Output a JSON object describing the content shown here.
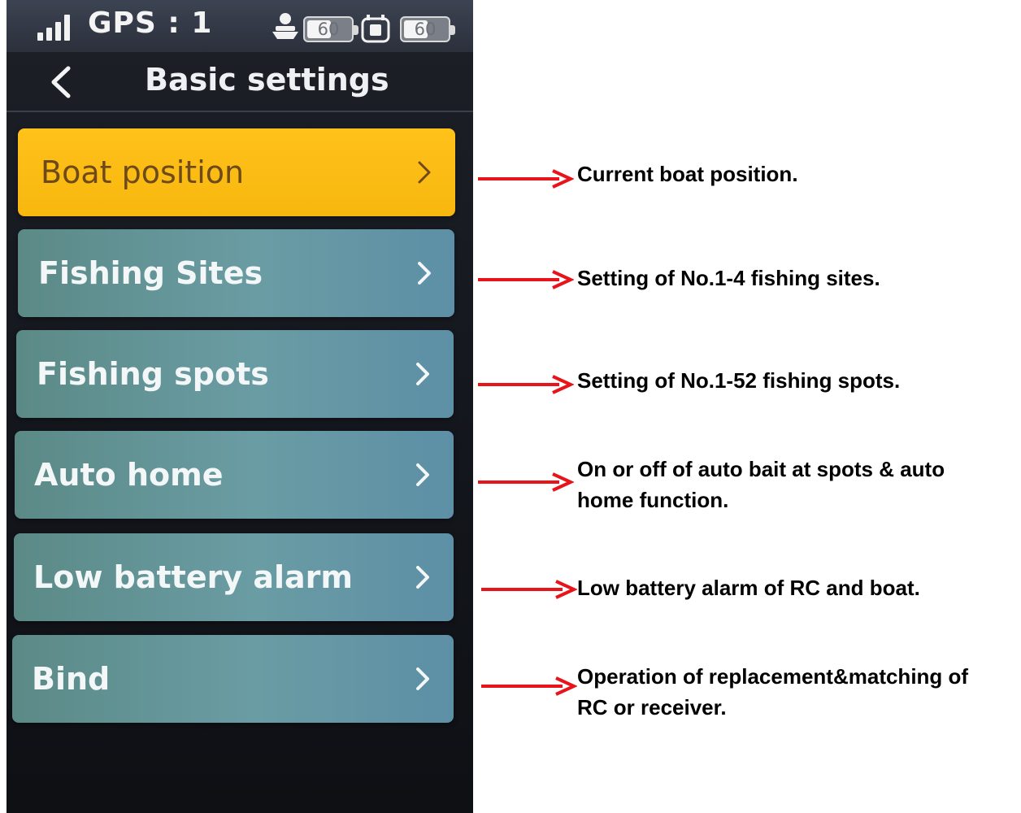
{
  "status_bar": {
    "gps_label": "GPS : 1",
    "signal_icon": "signal-bars-icon",
    "boat_icon": "boat-icon",
    "boat_battery": "60",
    "rc_icon": "remote-control-icon",
    "rc_battery": "60"
  },
  "header": {
    "back_icon": "chevron-left-icon",
    "title": "Basic settings"
  },
  "menu": {
    "items": [
      {
        "label": "Boat position",
        "state": "selected"
      },
      {
        "label": "Fishing Sites"
      },
      {
        "label": "Fishing spots"
      },
      {
        "label": "Auto home"
      },
      {
        "label": "Low battery alarm"
      },
      {
        "label": "Bind"
      }
    ]
  },
  "annotations": [
    "Current boat position.",
    "Setting of  No.1-4  fishing sites.",
    "Setting of No.1-52 fishing spots.",
    "On or off of auto bait at spots & auto\nhome function.",
    "Low battery alarm of RC and boat.",
    "Operation of replacement&matching of\nRC or receiver."
  ],
  "colors": {
    "active_item": "#f7b70f",
    "item_teal": "#6a9ca4",
    "arrow_red": "#e8141b"
  }
}
